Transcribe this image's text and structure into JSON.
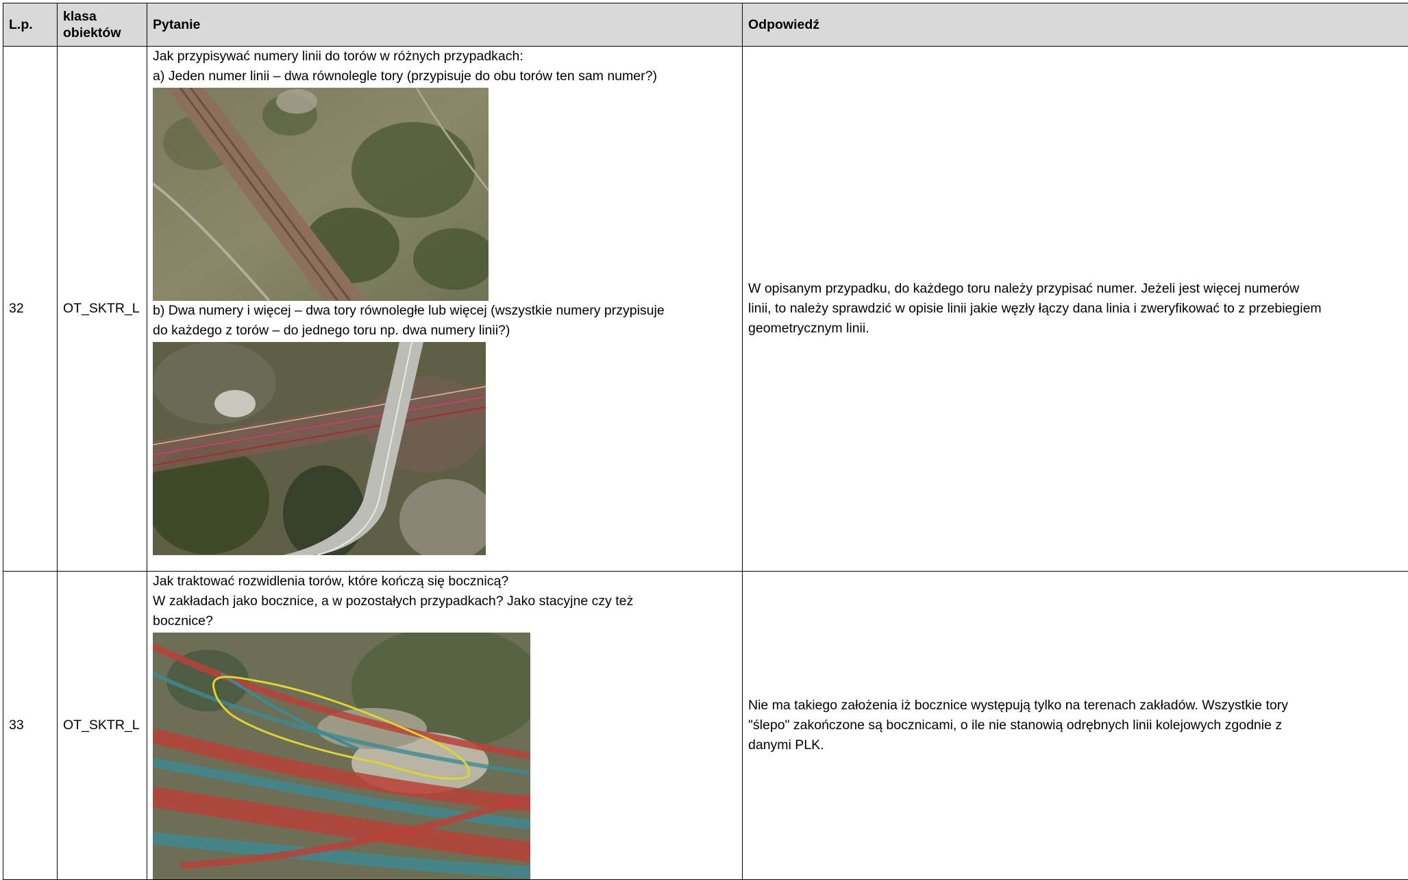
{
  "headers": {
    "lp": "L.p.",
    "klasa": "klasa obiektów",
    "pytanie": "Pytanie",
    "odpowiedz": "Odpowiedź"
  },
  "rows": [
    {
      "lp": "32",
      "klasa": "OT_SKTR_L",
      "question_a_intro": "Jak przypisywać numery linii do torów w różnych przypadkach:",
      "question_a": "a) Jeden numer linii – dwa równolegle tory (przypisuje do obu torów ten sam numer?)",
      "question_b_line1": "b) Dwa numery i więcej – dwa tory równoległe lub więcej (wszystkie numery przypisuje",
      "question_b_line2": "do każdego z torów – do jednego toru np. dwa numery linii?)",
      "answer_line1": "W opisanym przypadku, do każdego toru należy przypisać numer. Jeżeli jest więcej numerów",
      "answer_line2": "linii, to należy sprawdzić w opisie linii jakie węzły łączy dana linia i zweryfikować to z przebiegiem",
      "answer_line3": "geometrycznym linii."
    },
    {
      "lp": "33",
      "klasa": "OT_SKTR_L",
      "question_line1": "Jak traktować rozwidlenia torów, które kończą się bocznicą?",
      "question_line2": "W zakładach jako bocznice, a w pozostałych przypadkach? Jako stacyjne czy też",
      "question_line3": "bocznice?",
      "answer_line1": "Nie ma takiego założenia iż bocznice występują tylko na terenach zakładów. Wszystkie tory",
      "answer_line2": "\"ślepo\" zakończone są bocznicami, o ile nie stanowią odrębnych linii kolejowych zgodnie z",
      "answer_line3": "danymi PLK."
    }
  ]
}
